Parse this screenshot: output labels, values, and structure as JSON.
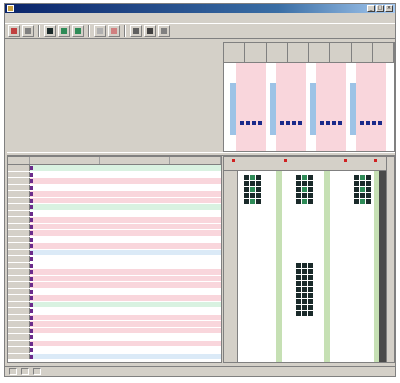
{
  "window": {
    "title": "",
    "controls": [
      "_",
      "□",
      "×"
    ]
  },
  "menubar": {
    "items": [
      "",
      "",
      "",
      "",
      "",
      ""
    ]
  },
  "toolbar": {
    "buttons": [
      {
        "name": "tool-1",
        "label": ""
      },
      {
        "name": "tool-2",
        "label": ""
      },
      {
        "name": "tool-3",
        "label": ""
      },
      {
        "name": "tool-4",
        "label": ""
      },
      {
        "name": "tool-5",
        "label": ""
      },
      {
        "name": "tool-6",
        "label": ""
      },
      {
        "name": "tool-7",
        "label": ""
      },
      {
        "name": "tool-8",
        "label": ""
      },
      {
        "name": "tool-9",
        "label": ""
      },
      {
        "name": "tool-10",
        "label": ""
      }
    ]
  },
  "colors": {
    "row_pink": "#f9d6dc",
    "row_green": "#d9f2e1",
    "row_blue": "#dbeaf7",
    "chart_blue": "#9dc3e6",
    "mark_dark": "#1a2a2a",
    "mark_green": "#2e8b57",
    "mark_red": "#d02020",
    "title_bar": "#0a246a"
  },
  "left_grid": {
    "columns": [
      "",
      "",
      "",
      ""
    ],
    "rows": [
      {
        "tint": "green",
        "num": "",
        "text": ""
      },
      {
        "tint": "white",
        "num": "",
        "text": ""
      },
      {
        "tint": "pink",
        "num": "",
        "text": ""
      },
      {
        "tint": "white",
        "num": "",
        "text": ""
      },
      {
        "tint": "pink",
        "num": "",
        "text": ""
      },
      {
        "tint": "pink",
        "num": "",
        "text": ""
      },
      {
        "tint": "green",
        "num": "",
        "text": ""
      },
      {
        "tint": "white",
        "num": "",
        "text": ""
      },
      {
        "tint": "pink",
        "num": "",
        "text": ""
      },
      {
        "tint": "pink",
        "num": "",
        "text": ""
      },
      {
        "tint": "pink",
        "num": "",
        "text": ""
      },
      {
        "tint": "white",
        "num": "",
        "text": ""
      },
      {
        "tint": "pink",
        "num": "",
        "text": ""
      },
      {
        "tint": "blue",
        "num": "",
        "text": ""
      },
      {
        "tint": "white",
        "num": "",
        "text": ""
      },
      {
        "tint": "white",
        "num": "",
        "text": ""
      },
      {
        "tint": "pink",
        "num": "",
        "text": ""
      },
      {
        "tint": "pink",
        "num": "",
        "text": ""
      },
      {
        "tint": "pink",
        "num": "",
        "text": ""
      },
      {
        "tint": "white",
        "num": "",
        "text": ""
      },
      {
        "tint": "pink",
        "num": "",
        "text": ""
      },
      {
        "tint": "green",
        "num": "",
        "text": ""
      },
      {
        "tint": "white",
        "num": "",
        "text": ""
      },
      {
        "tint": "pink",
        "num": "",
        "text": ""
      },
      {
        "tint": "pink",
        "num": "",
        "text": ""
      },
      {
        "tint": "pink",
        "num": "",
        "text": ""
      },
      {
        "tint": "white",
        "num": "",
        "text": ""
      },
      {
        "tint": "pink",
        "num": "",
        "text": ""
      },
      {
        "tint": "white",
        "num": "",
        "text": ""
      },
      {
        "tint": "blue",
        "num": "",
        "text": ""
      }
    ]
  },
  "statusbar": {
    "cells": [
      "",
      "",
      ""
    ]
  }
}
